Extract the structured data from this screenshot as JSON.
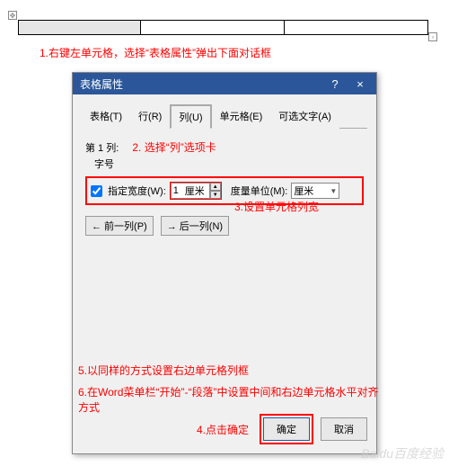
{
  "annotations": {
    "a1": "1.右键左单元格，选择“表格属性”弹出下面对话框",
    "a2": "2. 选择“列”选项卡",
    "a3": "3.设置单元格列宽",
    "a4": "4.点击确定",
    "a5": "5.以同样的方式设置右边单元格列框",
    "a6": "6.在Word菜单栏“开始”-“段落”中设置中间和右边单元格水平对齐方式"
  },
  "dialog": {
    "title": "表格属性",
    "help": "?",
    "close": "×",
    "tabs": {
      "table": "表格(T)",
      "row": "行(R)",
      "col": "列(U)",
      "cell": "单元格(E)",
      "alt": "可选文字(A)"
    },
    "col": {
      "header": "第 1 列:",
      "sizeLabel": "字号",
      "widthCheck": "指定宽度(W):",
      "widthValue": "1",
      "widthUnitSuffix": "厘米",
      "measureLabel": "度量单位(M):",
      "measureValue": "厘米",
      "prev": "← 前一列(P)",
      "next": "→ 后一列(N)"
    },
    "buttons": {
      "ok": "确定",
      "cancel": "取消"
    }
  },
  "watermark": "Baidu百度经验"
}
